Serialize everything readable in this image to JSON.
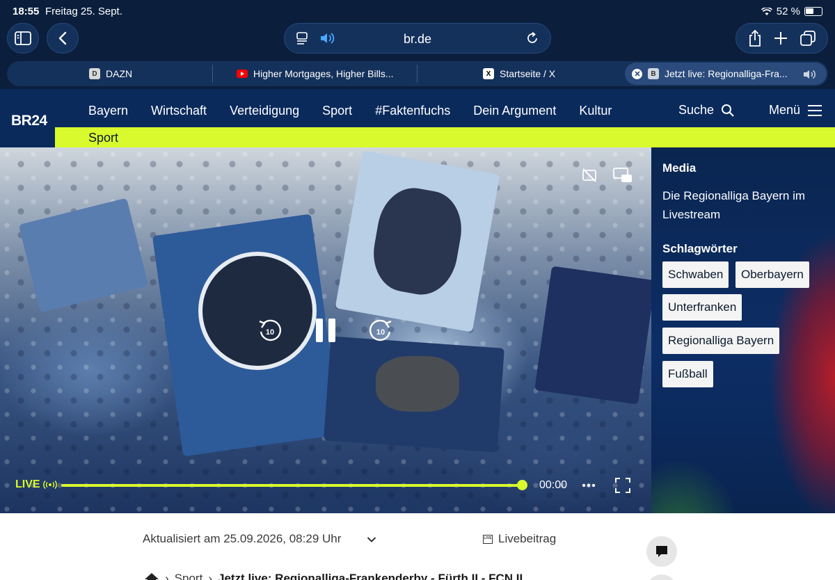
{
  "status": {
    "time": "18:55",
    "date": "Freitag 25. Sept.",
    "battery": "52 %"
  },
  "toolbar": {
    "url": "br.de"
  },
  "tabs": [
    {
      "label": "DAZN",
      "favicon": "D"
    },
    {
      "label": "Higher Mortgages, Higher Bills...",
      "favicon": "youtube-icon"
    },
    {
      "label": "Startseite / X",
      "favicon": "X"
    },
    {
      "label": "Jetzt live: Regionalliga-Fra...",
      "favicon": "B"
    }
  ],
  "site": {
    "logo": "BR24",
    "nav": [
      "Bayern",
      "Wirtschaft",
      "Verteidigung",
      "Sport",
      "#Faktenfuchs",
      "Dein Argument",
      "Kultur"
    ],
    "search_label": "Suche",
    "menu_label": "Menü",
    "section": "Sport",
    "accent": "#d9fa2c"
  },
  "player": {
    "live_label": "LIVE",
    "time": "00:00",
    "skip_back": "10",
    "skip_forward": "10",
    "progress": 1.0
  },
  "panel": {
    "media_heading": "Media",
    "media_text": "Die Regionalliga Bayern im Livestream",
    "tags_heading": "Schlagwörter",
    "tags": [
      "Schwaben",
      "Oberbayern",
      "Unterfranken",
      "Regionalliga Bayern",
      "Fußball"
    ]
  },
  "article": {
    "updated": "Aktualisiert am 25.09.2026, 08:29 Uhr",
    "type": "Livebeitrag",
    "live_icon_text": "LIVE",
    "breadcrumb": [
      "Sport",
      "Jetzt live: Regionalliga-Frankenderby - Fürth II - FCN II"
    ]
  }
}
